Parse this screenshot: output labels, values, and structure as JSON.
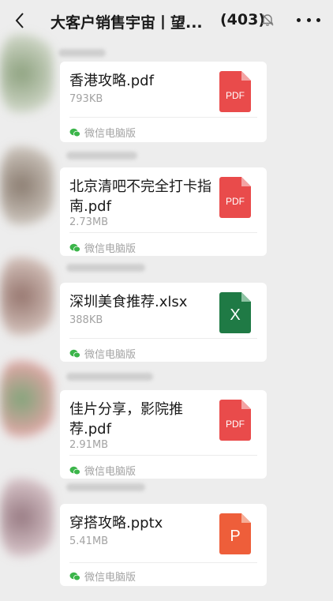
{
  "header": {
    "title": "大客户销售宇宙丨望...",
    "count": "(403)",
    "back_icon": "chevron-left-icon",
    "mute_icon": "bell-off-icon",
    "more_icon": "more-dots-icon"
  },
  "colors": {
    "pdf": "#e94b4b",
    "xlsx": "#1f7a45",
    "pptx": "#ee5e3a",
    "wechat_green": "#3bb54a"
  },
  "messages": [
    {
      "file_name": "香港攻略.pdf",
      "size": "793KB",
      "source": "微信电脑版",
      "icon_label": "PDF",
      "type": "pdf"
    },
    {
      "file_name": "北京清吧不完全打卡指南.pdf",
      "size": "2.73MB",
      "source": "微信电脑版",
      "icon_label": "PDF",
      "type": "pdf"
    },
    {
      "file_name": "深圳美食推荐.xlsx",
      "size": "388KB",
      "source": "微信电脑版",
      "icon_label": "X",
      "type": "xlsx"
    },
    {
      "file_name": "佳片分享，影院推荐.pdf",
      "size": "2.91MB",
      "source": "微信电脑版",
      "icon_label": "PDF",
      "type": "pdf"
    },
    {
      "file_name": "穿搭攻略.pptx",
      "size": "5.41MB",
      "source": "微信电脑版",
      "icon_label": "P",
      "type": "pptx"
    }
  ]
}
